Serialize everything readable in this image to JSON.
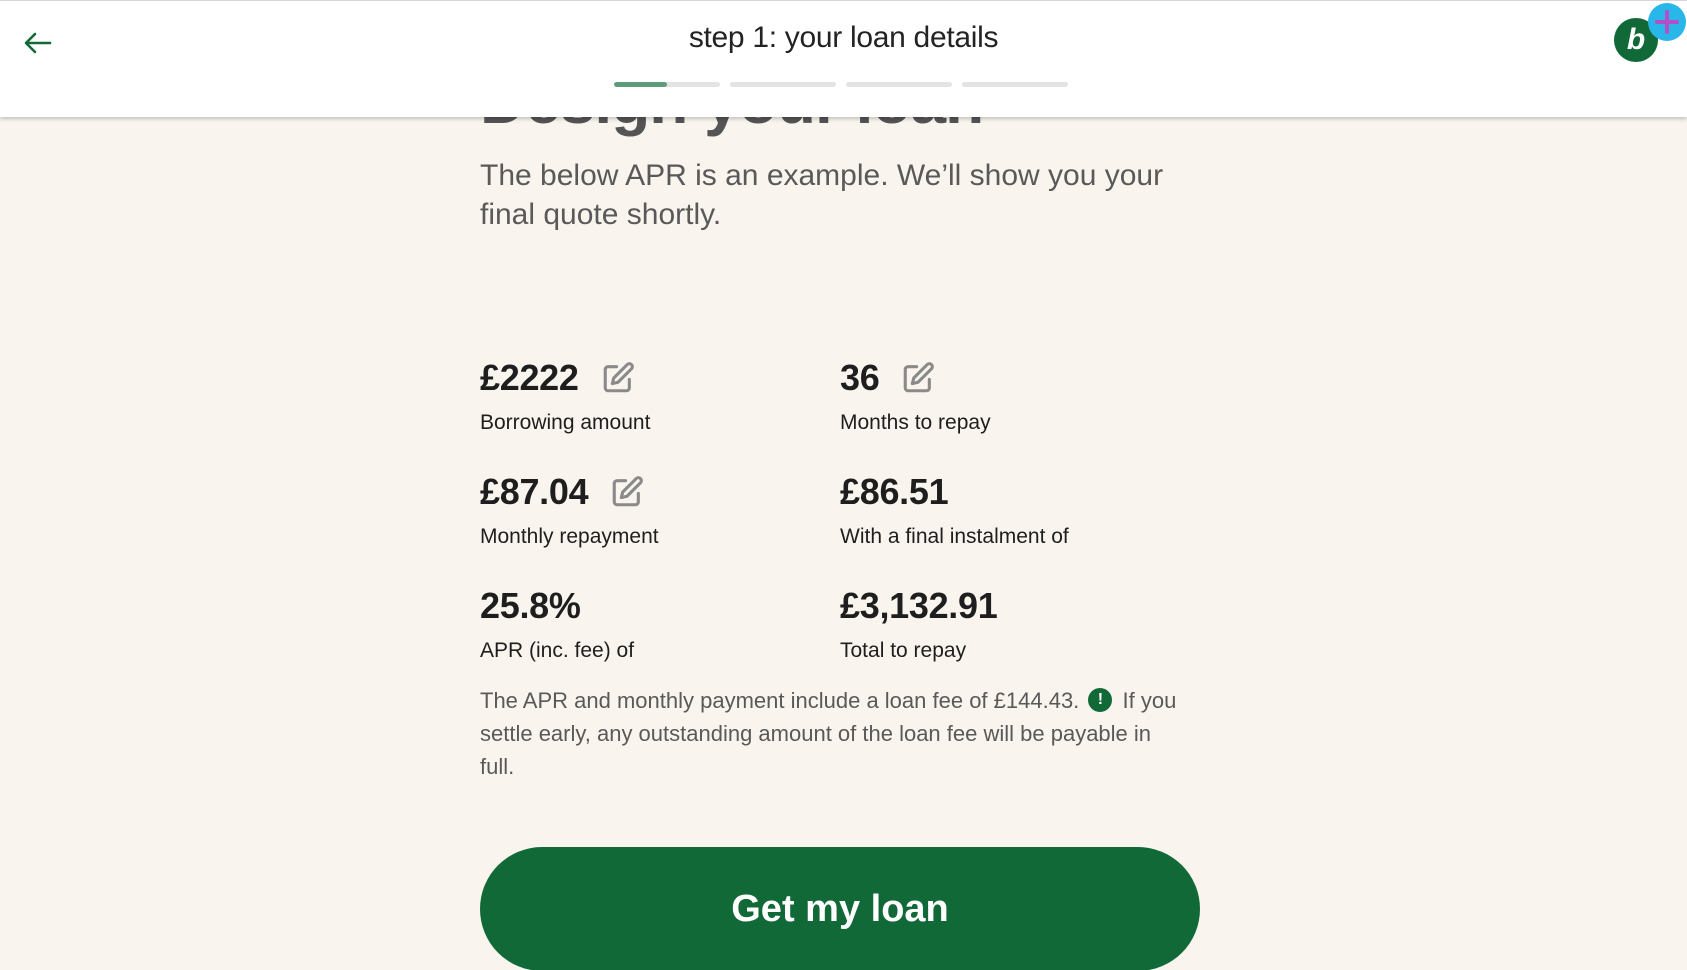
{
  "header": {
    "title": "step 1: your loan details",
    "back_icon": "arrow-left-icon",
    "progress": {
      "segments": 4,
      "current_step": 1,
      "current_fill": 0.5
    },
    "avatar_letter": "b",
    "avatar_badge_icon": "plus-icon"
  },
  "colors": {
    "brand_green": "#116938",
    "progress_fill": "#5d9c78",
    "background": "#f9f5ee",
    "badge_blue": "#29b6e8",
    "badge_plus": "#b44fc8"
  },
  "main": {
    "heading_partial": "Design your loan",
    "intro": "The below APR is an example. We’ll show you your final quote shortly.",
    "stats": [
      {
        "value": "£2222",
        "label": "Borrowing amount",
        "editable": true
      },
      {
        "value": "36",
        "label": "Months to repay",
        "editable": true
      },
      {
        "value": "£87.04",
        "label": "Monthly repayment",
        "editable": true
      },
      {
        "value": "£86.51",
        "label": "With a final instalment of",
        "editable": false
      },
      {
        "value": "25.8%",
        "label": "APR (inc. fee) of",
        "editable": false
      },
      {
        "value": "£3,132.91",
        "label": "Total to repay",
        "editable": false
      }
    ],
    "fee_note_before": "The APR and monthly payment include a loan fee of £144.43.",
    "fee_note_icon": "!",
    "fee_note_after": "If you settle early, any outstanding amount of the loan fee will be payable in full.",
    "cta_label": "Get my loan"
  }
}
